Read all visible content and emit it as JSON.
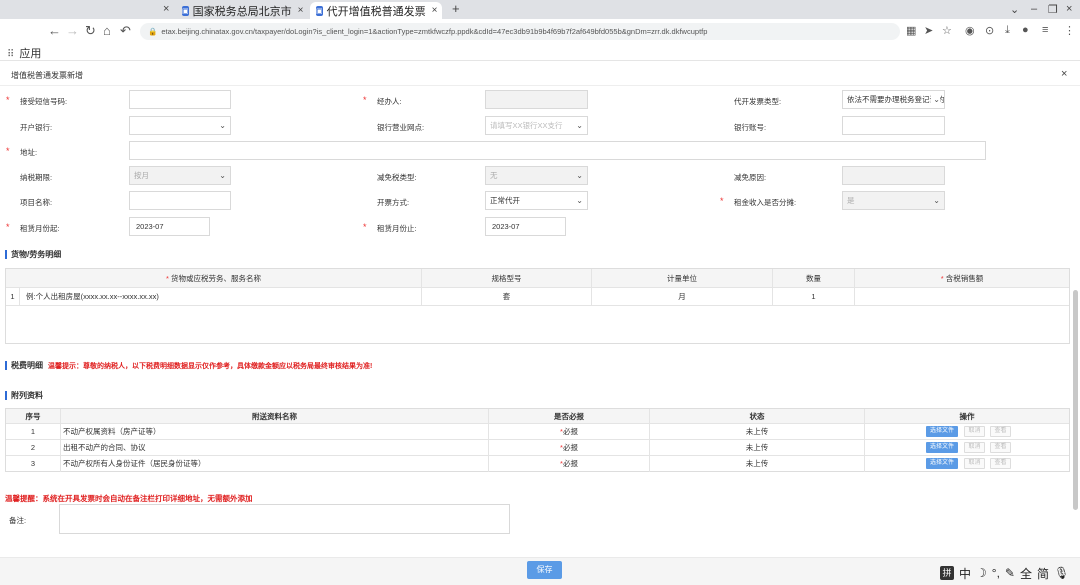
{
  "browser": {
    "tabs": [
      {
        "label": "国家税务总局北京市",
        "icon": "tax-site-icon"
      },
      {
        "label": "代开增值税普通发票",
        "icon": "tax-site-icon",
        "active": true
      }
    ],
    "url": "etax.beijing.chinatax.gov.cn/taxpayer/doLogin?is_client_login=1&actionType=zmtkfwczfp.ppdk&cdId=47ec3db91b9b4f69b7f2af649bfd055b&gnDm=zrr.dk.dkfwcuptfp",
    "bookmarks_apps": "应用"
  },
  "page": {
    "title": "增值税普通发票新增",
    "close": "×"
  },
  "form": {
    "sms_phone": {
      "label": "接受短信号码:",
      "value": ""
    },
    "operator": {
      "label": "经办人:",
      "value": ""
    },
    "invoice_type": {
      "label": "代开发票类型:",
      "value": "依法不需要办理税务登记证的"
    },
    "bank": {
      "label": "开户银行:",
      "value": ""
    },
    "bank_branch": {
      "label": "银行营业网点:",
      "placeholder": "请填写XX银行XX支行"
    },
    "bank_account": {
      "label": "银行账号:",
      "value": ""
    },
    "address": {
      "label": "地址:",
      "value": ""
    },
    "tax_period": {
      "label": "纳税期限:",
      "value": "按月"
    },
    "exemption_type": {
      "label": "减免税类型:",
      "value": "无"
    },
    "exemption_reason": {
      "label": "减免原因:",
      "value": ""
    },
    "project_name": {
      "label": "项目名称:",
      "value": ""
    },
    "issue_method": {
      "label": "开票方式:",
      "value": "正常代开"
    },
    "rent_split": {
      "label": "租金收入是否分摊:",
      "value": "是"
    },
    "rent_start": {
      "label": "租赁月份起:",
      "value": "2023-07"
    },
    "rent_end": {
      "label": "租赁月份止:",
      "value": "2023-07"
    }
  },
  "goods": {
    "section_title": "货物/劳务明细",
    "headers": [
      "货物或应税劳务、服务名称",
      "规格型号",
      "计量单位",
      "数量",
      "含税销售额"
    ],
    "rows": [
      {
        "no": "1",
        "name": "例:个人出租房屋(xxxx.xx.xx--xxxx.xx.xx)",
        "spec": "套",
        "unit": "月",
        "qty": "1",
        "amount": ""
      }
    ]
  },
  "tax_detail": {
    "section_title": "税费明细",
    "notice": "温馨提示：尊敬的纳税人，以下税费明细数据显示仅作参考，具体缴款金额应以税务局最终审核结果为准!"
  },
  "attachments": {
    "section_title": "附列资料",
    "headers": [
      "序号",
      "附送资料名称",
      "是否必报",
      "状态",
      "操作"
    ],
    "rows": [
      {
        "no": "1",
        "name": "不动产权属资料（房产证等）",
        "required": "必报",
        "status": "未上传"
      },
      {
        "no": "2",
        "name": "出租不动产的合同、协议",
        "required": "必报",
        "status": "未上传"
      },
      {
        "no": "3",
        "name": "不动产权所有人身份证件（居民身份证等）",
        "required": "必报",
        "status": "未上传"
      }
    ],
    "btn_choose": "选择文件",
    "btn_cancel": "取消",
    "btn_view": "查看"
  },
  "reminder": "温馨提醒：系统在开具发票时会自动在备注栏打印详细地址，无需额外添加",
  "remark": {
    "label": "备注:",
    "value": ""
  },
  "save_label": "保存",
  "ime": {
    "chars": [
      "中",
      "全",
      "简"
    ]
  }
}
